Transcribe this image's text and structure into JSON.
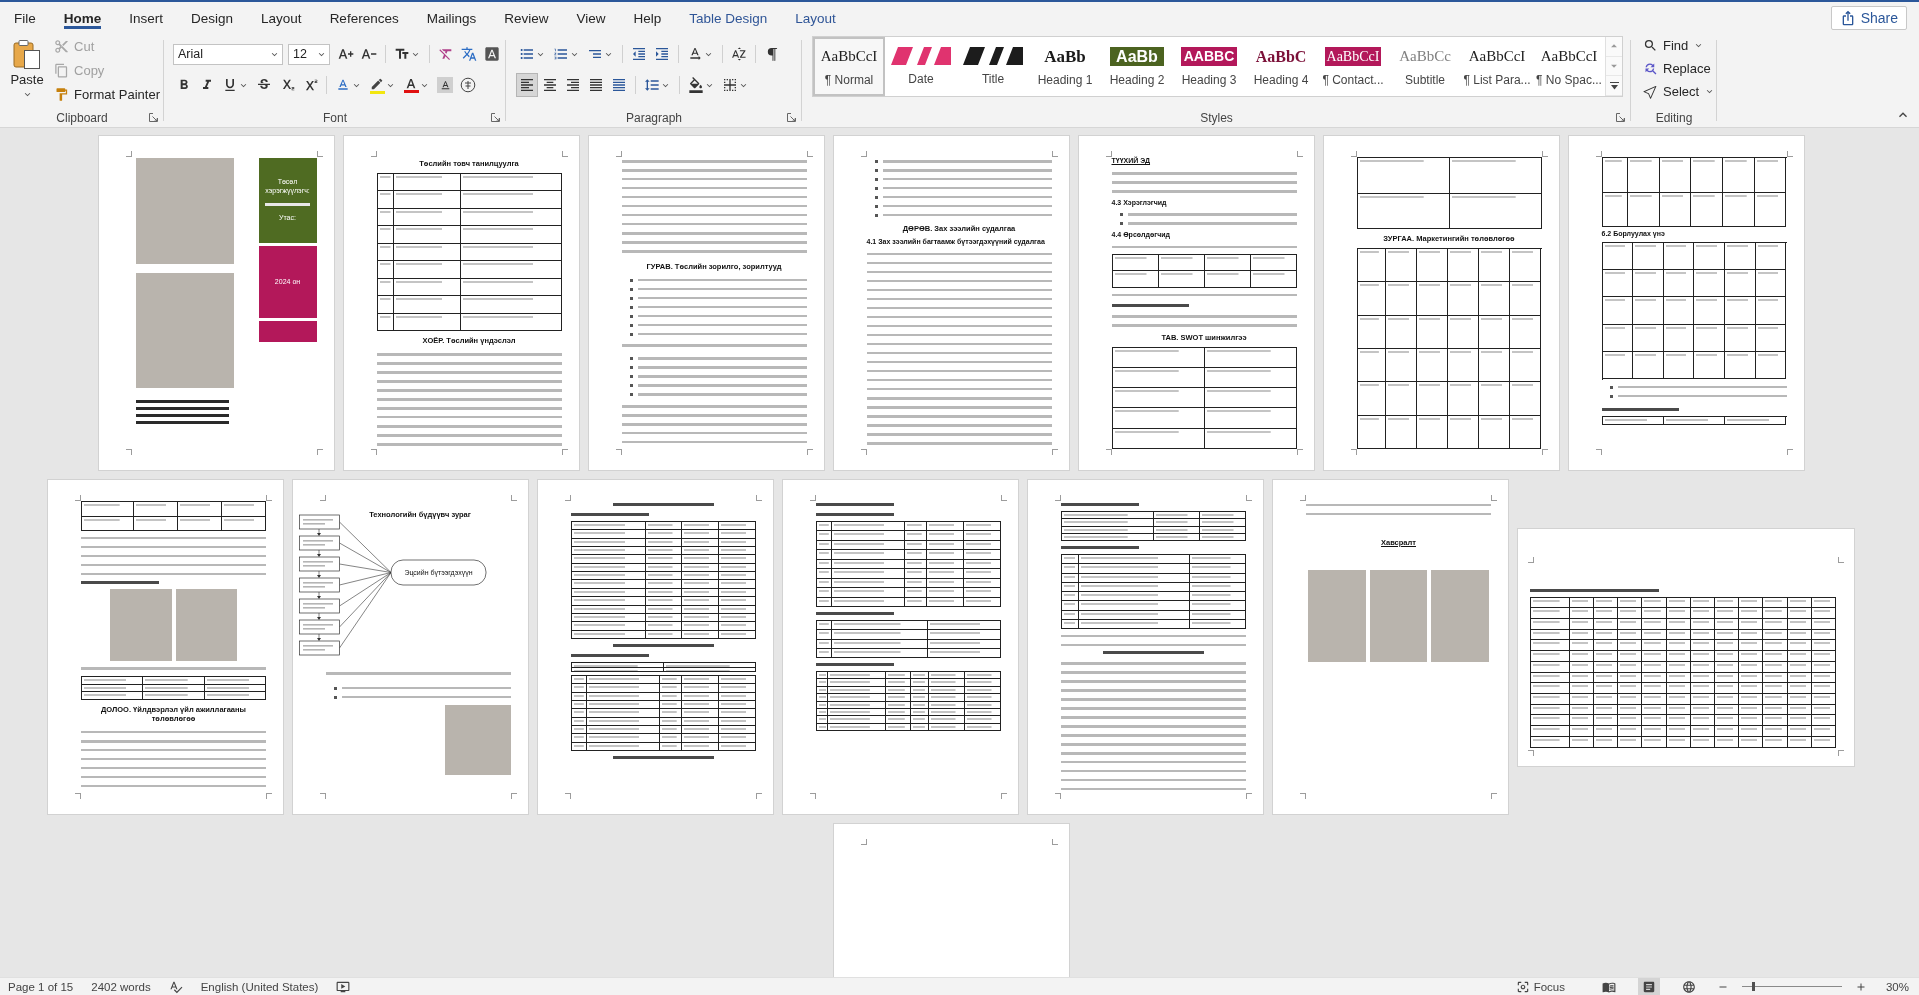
{
  "tabs": [
    {
      "label": "File",
      "kind": "main",
      "selected": false
    },
    {
      "label": "Home",
      "kind": "main",
      "selected": true
    },
    {
      "label": "Insert",
      "kind": "main",
      "selected": false
    },
    {
      "label": "Design",
      "kind": "main",
      "selected": false
    },
    {
      "label": "Layout",
      "kind": "main",
      "selected": false
    },
    {
      "label": "References",
      "kind": "main",
      "selected": false
    },
    {
      "label": "Mailings",
      "kind": "main",
      "selected": false
    },
    {
      "label": "Review",
      "kind": "main",
      "selected": false
    },
    {
      "label": "View",
      "kind": "main",
      "selected": false
    },
    {
      "label": "Help",
      "kind": "main",
      "selected": false
    },
    {
      "label": "Table Design",
      "kind": "contextual",
      "selected": false
    },
    {
      "label": "Layout",
      "kind": "contextual",
      "selected": false
    }
  ],
  "share": "Share",
  "ribbon": {
    "clipboard": {
      "label": "Clipboard",
      "paste": "Paste",
      "items": [
        {
          "kind": "cut",
          "label": "Cut",
          "disabled": true
        },
        {
          "kind": "copy",
          "label": "Copy",
          "disabled": true
        },
        {
          "kind": "format-painter",
          "label": "Format Painter",
          "disabled": false
        }
      ]
    },
    "font": {
      "label": "Font",
      "font_name": "Arial",
      "font_size": "12"
    },
    "paragraph": {
      "label": "Paragraph",
      "alignments": [
        {
          "kind": "left",
          "selected": true
        },
        {
          "kind": "center",
          "selected": false
        },
        {
          "kind": "right",
          "selected": false
        },
        {
          "kind": "justify",
          "selected": false
        },
        {
          "kind": "distributed",
          "selected": false
        }
      ]
    },
    "styles": {
      "label": "Styles",
      "items": [
        {
          "kind": "normal",
          "preview": "AaBbCcI",
          "label": "¶ Normal",
          "selected": true
        },
        {
          "kind": "date",
          "label": "Date",
          "selected": false
        },
        {
          "kind": "title",
          "label": "Title",
          "selected": false
        },
        {
          "kind": "heading1",
          "preview": "AaBb",
          "label": "Heading 1",
          "selected": false
        },
        {
          "kind": "heading2",
          "preview": "AaBb",
          "label": "Heading 2",
          "selected": false
        },
        {
          "kind": "heading3",
          "preview": "AABBC",
          "label": "Heading 3",
          "selected": false
        },
        {
          "kind": "heading4",
          "preview": "AaBbC",
          "label": "Heading 4",
          "selected": false
        },
        {
          "kind": "contact",
          "preview": "AaBbCcI",
          "label": "¶ Contact...",
          "selected": false
        },
        {
          "kind": "subtitle",
          "preview": "AaBbCc",
          "label": "Subtitle",
          "selected": false
        },
        {
          "kind": "plain",
          "preview": "AaBbCcI",
          "label": "¶ List Para...",
          "selected": false
        },
        {
          "kind": "plain",
          "preview": "AaBbCcI",
          "label": "¶ No Spac...",
          "selected": false
        }
      ]
    },
    "editing": {
      "label": "Editing",
      "items": [
        {
          "kind": "find",
          "label": "Find"
        },
        {
          "kind": "replace",
          "label": "Replace"
        },
        {
          "kind": "select",
          "label": "Select"
        }
      ]
    }
  },
  "document": {
    "pages": [
      {
        "kind": "cover",
        "photos": [
          {
            "kind": "photo"
          },
          {
            "kind": "photo"
          }
        ],
        "panels": [
          {
            "kind": "info",
            "color": "#4f6b22",
            "items": [
              {
                "kind": "text",
                "text": "Төсөл хэрэгжүүлэгч:"
              },
              {
                "kind": "line"
              },
              {
                "kind": "text",
                "text": "Утас:"
              }
            ]
          },
          {
            "kind": "year",
            "color": "#b3185a",
            "items": [
              {
                "kind": "text",
                "text": "2024 он"
              }
            ]
          },
          {
            "kind": "band",
            "color": "#b3185a"
          }
        ]
      },
      {
        "kind": "portrait",
        "blocks": [
          {
            "kind": "title",
            "text": "Төслийн товч танилцуулга"
          },
          {
            "kind": "table"
          },
          {
            "kind": "title",
            "text": "ХОЁР. Төслийн үндэслэл"
          },
          {
            "kind": "text"
          }
        ]
      },
      {
        "kind": "portrait",
        "blocks": [
          {
            "kind": "text"
          },
          {
            "kind": "title",
            "text": "ГУРАВ. Төслийн зорилго, зорилтууд"
          },
          {
            "kind": "bullets"
          },
          {
            "kind": "text"
          },
          {
            "kind": "bullets"
          },
          {
            "kind": "text"
          }
        ]
      },
      {
        "kind": "portrait",
        "blocks": [
          {
            "kind": "bullets"
          },
          {
            "kind": "title",
            "text": "ДӨРӨВ. Зах зээлийн судалгаа"
          },
          {
            "kind": "heading",
            "text": "4.1 Зах зээлийн багтаамж бүтээгдэхүүний судалгаа"
          },
          {
            "kind": "text"
          }
        ]
      },
      {
        "kind": "portrait",
        "blocks": [
          {
            "kind": "heading",
            "text": "ТҮҮХИЙ ЭД",
            "underlined": true
          },
          {
            "kind": "text"
          },
          {
            "kind": "heading",
            "text": "4.3 Хэрэглэгчид"
          },
          {
            "kind": "bullets"
          },
          {
            "kind": "heading",
            "text": "4.4 Өрсөлдөгчид"
          },
          {
            "kind": "text"
          },
          {
            "kind": "table"
          },
          {
            "kind": "text"
          },
          {
            "kind": "heading-line"
          },
          {
            "kind": "text"
          },
          {
            "kind": "title",
            "text": "ТАВ. SWOT шинжилгээ"
          },
          {
            "kind": "table"
          }
        ]
      },
      {
        "kind": "portrait",
        "blocks": [
          {
            "kind": "table"
          },
          {
            "kind": "title",
            "text": "ЗУРГАА. Маркетингийн төлөвлөгөө"
          },
          {
            "kind": "table"
          }
        ]
      },
      {
        "kind": "portrait",
        "blocks": [
          {
            "kind": "table"
          },
          {
            "kind": "heading",
            "text": "6.2 Борлуулах үнэ"
          },
          {
            "kind": "table"
          },
          {
            "kind": "bullets"
          },
          {
            "kind": "heading-line"
          },
          {
            "kind": "table"
          }
        ]
      },
      {
        "kind": "portrait",
        "blocks": [
          {
            "kind": "table"
          },
          {
            "kind": "text"
          },
          {
            "kind": "heading-line"
          },
          {
            "kind": "photos",
            "items": [
              {
                "kind": "photo"
              },
              {
                "kind": "photo"
              }
            ]
          },
          {
            "kind": "text"
          },
          {
            "kind": "table"
          },
          {
            "kind": "title",
            "text": "ДОЛОО. Үйлдвэрлэл үйл ажиллагааны төлөвлөгөө"
          },
          {
            "kind": "text"
          }
        ]
      },
      {
        "kind": "portrait",
        "blocks": [
          {
            "kind": "diagram",
            "title": "Технологийн бүдүүвч зураг",
            "node": "Эцсийн бүтээгдэхүүн"
          },
          {
            "kind": "text"
          },
          {
            "kind": "bullets"
          },
          {
            "kind": "photos",
            "items": [
              {
                "kind": "photo"
              }
            ]
          }
        ]
      },
      {
        "kind": "portrait",
        "blocks": [
          {
            "kind": "title-line"
          },
          {
            "kind": "heading-line"
          },
          {
            "kind": "table"
          },
          {
            "kind": "title-line"
          },
          {
            "kind": "heading-line"
          },
          {
            "kind": "table"
          },
          {
            "kind": "table"
          },
          {
            "kind": "title-line"
          }
        ]
      },
      {
        "kind": "portrait",
        "blocks": [
          {
            "kind": "heading-line"
          },
          {
            "kind": "heading-line"
          },
          {
            "kind": "table"
          },
          {
            "kind": "heading-line"
          },
          {
            "kind": "table"
          },
          {
            "kind": "heading-line"
          },
          {
            "kind": "table"
          }
        ]
      },
      {
        "kind": "portrait",
        "blocks": [
          {
            "kind": "heading-line"
          },
          {
            "kind": "table"
          },
          {
            "kind": "heading-line"
          },
          {
            "kind": "table"
          },
          {
            "kind": "text"
          },
          {
            "kind": "title-line"
          },
          {
            "kind": "text"
          }
        ]
      },
      {
        "kind": "portrait",
        "blocks": [
          {
            "kind": "text"
          },
          {
            "kind": "title",
            "text": "Хавсралт",
            "underlined": true
          },
          {
            "kind": "photos",
            "items": [
              {
                "kind": "photo"
              },
              {
                "kind": "photo"
              },
              {
                "kind": "photo"
              }
            ]
          }
        ]
      },
      {
        "kind": "landscape",
        "blocks": [
          {
            "kind": "heading-line"
          },
          {
            "kind": "table"
          }
        ]
      },
      {
        "kind": "portrait"
      }
    ]
  },
  "status_bar": {
    "page": "Page 1 of 15",
    "words": "2402 words",
    "language": "English (United States)",
    "focus": "Focus",
    "views": [
      {
        "kind": "read",
        "selected": false
      },
      {
        "kind": "print",
        "selected": true
      },
      {
        "kind": "web",
        "selected": false
      }
    ],
    "zoom": {
      "level": 0.11,
      "percent": "30%"
    }
  }
}
